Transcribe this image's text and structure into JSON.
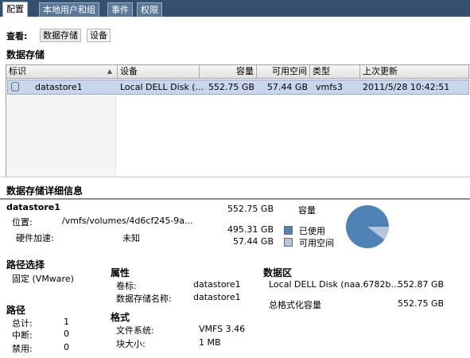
{
  "tabs": [
    "配置",
    "本地用户和组",
    "事件",
    "权限"
  ],
  "view": {
    "label": "查看:",
    "btn_datastore": "数据存储",
    "btn_device": "设备"
  },
  "datastores": {
    "title": "数据存储",
    "columns": [
      "标识",
      "设备",
      "容量",
      "可用空间",
      "类型",
      "上次更新"
    ],
    "rows": [
      {
        "name": "datastore1",
        "device": "Local DELL Disk (...",
        "capacity": "552.75 GB",
        "free": "57.44 GB",
        "type": "vmfs3",
        "updated": "2011/5/28 10:42:51"
      }
    ]
  },
  "details": {
    "title": "数据存储详细信息",
    "name": "datastore1",
    "location_label": "位置:",
    "location_value": "/vmfs/volumes/4d6cf245-9a...",
    "hw_accel_label": "硬件加速:",
    "hw_accel_value": "未知",
    "capacity_value": "552.75 GB",
    "capacity_label": "容量",
    "used_value": "495.31 GB",
    "used_label": "已使用",
    "free_value": "57.44 GB",
    "free_label": "可用空间",
    "used_fraction": 0.8961,
    "used_color": "#4f82b5",
    "free_color": "#b3c6dd"
  },
  "path_selection": {
    "title": "路径选择",
    "value": "固定 (VMware)"
  },
  "paths": {
    "title": "路径",
    "total_label": "总计:",
    "total_value": "1",
    "broken_label": "中断:",
    "broken_value": "0",
    "disabled_label": "禁用:",
    "disabled_value": "0"
  },
  "properties": {
    "title": "属性",
    "volume_label": "卷标:",
    "volume_value": "datastore1",
    "dsname_label": "数据存储名称:",
    "dsname_value": "datastore1",
    "format_title": "格式",
    "fs_label": "文件系统:",
    "fs_value": "VMFS 3.46",
    "block_label": "块大小:",
    "block_value": "1 MB"
  },
  "extents": {
    "title": "数据区",
    "disk_label": "Local DELL Disk (naa.6782b...",
    "disk_value": "552.87 GB",
    "formatted_label": "总格式化容量",
    "formatted_value": "552.75 GB"
  }
}
